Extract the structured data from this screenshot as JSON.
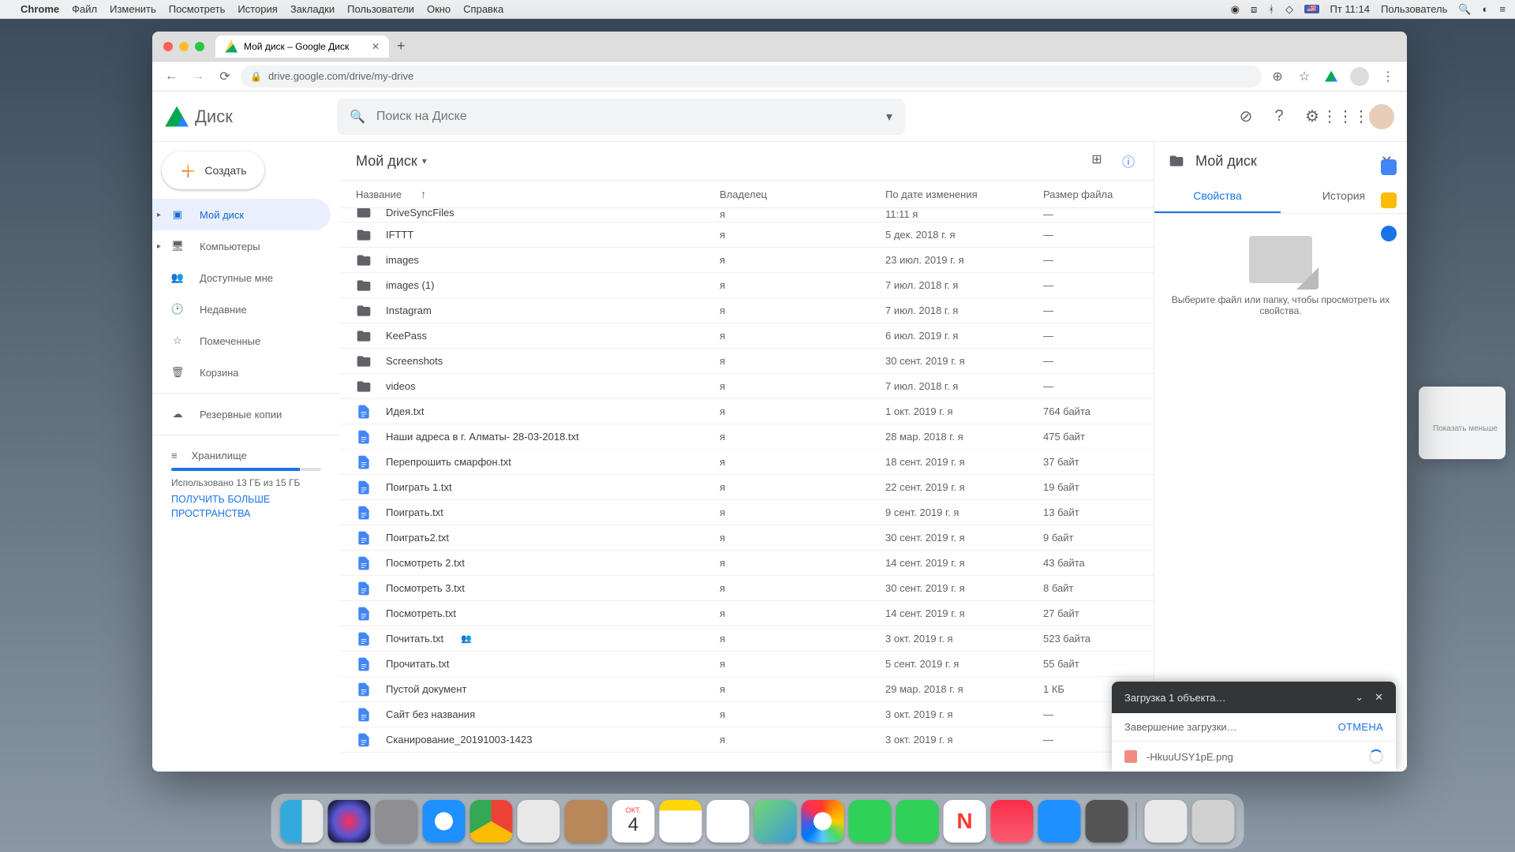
{
  "menubar": {
    "app": "Chrome",
    "items": [
      "Файл",
      "Изменить",
      "Посмотреть",
      "История",
      "Закладки",
      "Пользователи",
      "Окно",
      "Справка"
    ],
    "time": "Пт 11:14",
    "user": "Пользователь"
  },
  "browser": {
    "tab_title": "Мой диск – Google Диск",
    "url": "drive.google.com/drive/my-drive"
  },
  "drive": {
    "product": "Диск",
    "search_placeholder": "Поиск на Диске",
    "create_label": "Создать",
    "nav": [
      {
        "label": "Мой диск",
        "icon": "drive",
        "active": true,
        "expandable": true
      },
      {
        "label": "Компьютеры",
        "icon": "devices",
        "expandable": true
      },
      {
        "label": "Доступные мне",
        "icon": "shared"
      },
      {
        "label": "Недавние",
        "icon": "clock"
      },
      {
        "label": "Помеченные",
        "icon": "star"
      },
      {
        "label": "Корзина",
        "icon": "trash"
      }
    ],
    "backup_label": "Резервные копии",
    "storage_label": "Хранилище",
    "storage_used": "Использовано 13 ГБ из 15 ГБ",
    "storage_more": "ПОЛУЧИТЬ БОЛЬШЕ ПРОСТРАНСТВА",
    "breadcrumb": "Мой диск",
    "columns": {
      "name": "Название",
      "owner": "Владелец",
      "date": "По дате изменения",
      "size": "Размер файла"
    },
    "files": [
      {
        "type": "folder",
        "name": "DriveSyncFiles",
        "owner": "я",
        "date": "11:11  я",
        "size": "—",
        "partial": true
      },
      {
        "type": "folder",
        "name": "IFTTT",
        "owner": "я",
        "date": "5 дек. 2018 г.  я",
        "size": "—"
      },
      {
        "type": "folder",
        "name": "images",
        "owner": "я",
        "date": "23 июл. 2019 г.  я",
        "size": "—"
      },
      {
        "type": "folder",
        "name": "images (1)",
        "owner": "я",
        "date": "7 июл. 2018 г.  я",
        "size": "—"
      },
      {
        "type": "folder",
        "name": "Instagram",
        "owner": "я",
        "date": "7 июл. 2018 г.  я",
        "size": "—"
      },
      {
        "type": "folder",
        "name": "KeePass",
        "owner": "я",
        "date": "6 июл. 2019 г.  я",
        "size": "—"
      },
      {
        "type": "folder",
        "name": "Screenshots",
        "owner": "я",
        "date": "30 сент. 2019 г.  я",
        "size": "—"
      },
      {
        "type": "folder",
        "name": "videos",
        "owner": "я",
        "date": "7 июл. 2018 г.  я",
        "size": "—"
      },
      {
        "type": "doc",
        "name": "Идея.txt",
        "owner": "я",
        "date": "1 окт. 2019 г.  я",
        "size": "764 байта"
      },
      {
        "type": "doc",
        "name": "Наши адреса в г. Алматы- 28-03-2018.txt",
        "owner": "я",
        "date": "28 мар. 2018 г.  я",
        "size": "475 байт"
      },
      {
        "type": "doc",
        "name": "Перепрошить смарфон.txt",
        "owner": "я",
        "date": "18 сент. 2019 г.  я",
        "size": "37 байт"
      },
      {
        "type": "doc",
        "name": "Поиграть 1.txt",
        "owner": "я",
        "date": "22 сент. 2019 г.  я",
        "size": "19 байт"
      },
      {
        "type": "doc",
        "name": "Поиграть.txt",
        "owner": "я",
        "date": "9 сент. 2019 г.  я",
        "size": "13 байт"
      },
      {
        "type": "doc",
        "name": "Поиграть2.txt",
        "owner": "я",
        "date": "30 сент. 2019 г.  я",
        "size": "9 байт"
      },
      {
        "type": "doc",
        "name": "Посмотреть 2.txt",
        "owner": "я",
        "date": "14 сент. 2019 г.  я",
        "size": "43 байта"
      },
      {
        "type": "doc",
        "name": "Посмотреть 3.txt",
        "owner": "я",
        "date": "30 сент. 2019 г.  я",
        "size": "8 байт"
      },
      {
        "type": "doc",
        "name": "Посмотреть.txt",
        "owner": "я",
        "date": "14 сент. 2019 г.  я",
        "size": "27 байт"
      },
      {
        "type": "doc",
        "name": "Почитать.txt",
        "owner": "я",
        "date": "3 окт. 2019 г.  я",
        "size": "523 байта",
        "shared": true
      },
      {
        "type": "doc",
        "name": "Прочитать.txt",
        "owner": "я",
        "date": "5 сент. 2019 г.  я",
        "size": "55 байт"
      },
      {
        "type": "gdoc",
        "name": "Пустой документ",
        "owner": "я",
        "date": "29 мар. 2018 г.  я",
        "size": "1 КБ"
      },
      {
        "type": "gdoc",
        "name": "Сайт без названия",
        "owner": "я",
        "date": "3 окт. 2019 г.  я",
        "size": "—"
      },
      {
        "type": "gdoc",
        "name": "Сканирование_20191003-1423",
        "owner": "я",
        "date": "3 окт. 2019 г.  я",
        "size": "—"
      }
    ],
    "details": {
      "title": "Мой диск",
      "tab_props": "Свойства",
      "tab_history": "История",
      "hint": "Выберите файл или папку, чтобы просмотреть их свойства."
    },
    "upload": {
      "title": "Загрузка 1 объекта…",
      "status": "Завершение загрузки…",
      "cancel": "ОТМЕНА",
      "filename": "-HkuuUSY1pE.png"
    }
  },
  "bg_panel": {
    "link": "Показать меньше"
  }
}
